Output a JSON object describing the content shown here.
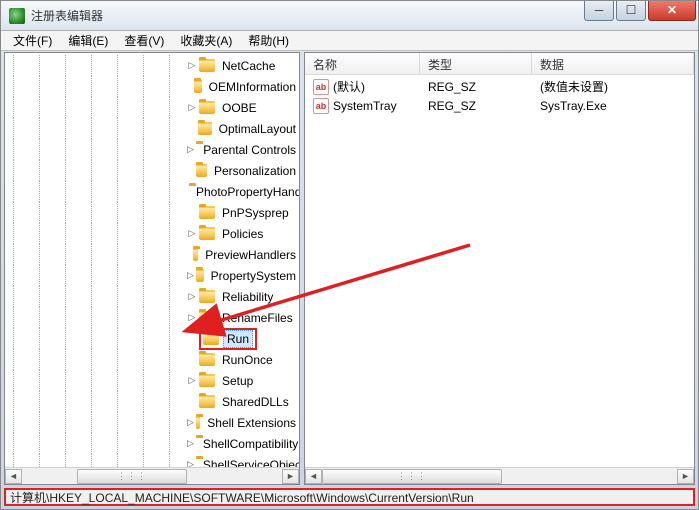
{
  "window": {
    "title": "注册表编辑器"
  },
  "menu": {
    "file": "文件(F)",
    "edit": "编辑(E)",
    "view": "查看(V)",
    "fav": "收藏夹(A)",
    "help": "帮助(H)"
  },
  "tree": {
    "items": [
      {
        "label": "NetCache",
        "expander": "▷"
      },
      {
        "label": "OEMInformation",
        "expander": ""
      },
      {
        "label": "OOBE",
        "expander": "▷"
      },
      {
        "label": "OptimalLayout",
        "expander": ""
      },
      {
        "label": "Parental Controls",
        "expander": "▷"
      },
      {
        "label": "Personalization",
        "expander": ""
      },
      {
        "label": "PhotoPropertyHandl",
        "expander": ""
      },
      {
        "label": "PnPSysprep",
        "expander": ""
      },
      {
        "label": "Policies",
        "expander": "▷"
      },
      {
        "label": "PreviewHandlers",
        "expander": ""
      },
      {
        "label": "PropertySystem",
        "expander": "▷"
      },
      {
        "label": "Reliability",
        "expander": "▷"
      },
      {
        "label": "RenameFiles",
        "expander": "▷"
      },
      {
        "label": "Run",
        "expander": "",
        "selected": true
      },
      {
        "label": "RunOnce",
        "expander": ""
      },
      {
        "label": "Setup",
        "expander": "▷"
      },
      {
        "label": "SharedDLLs",
        "expander": ""
      },
      {
        "label": "Shell Extensions",
        "expander": "▷"
      },
      {
        "label": "ShellCompatibility",
        "expander": "▷"
      },
      {
        "label": "ShellServiceObjectDe",
        "expander": "▷"
      }
    ]
  },
  "list": {
    "headers": {
      "name": "名称",
      "type": "类型",
      "data": "数据"
    },
    "rows": [
      {
        "name": "(默认)",
        "type": "REG_SZ",
        "data": "(数值未设置)"
      },
      {
        "name": "SystemTray",
        "type": "REG_SZ",
        "data": "SysTray.Exe"
      }
    ]
  },
  "status": {
    "path": "计算机\\HKEY_LOCAL_MACHINE\\SOFTWARE\\Microsoft\\Windows\\CurrentVersion\\Run"
  },
  "icons": {
    "string_value": "ab"
  },
  "colors": {
    "annotation": "#e02020"
  }
}
